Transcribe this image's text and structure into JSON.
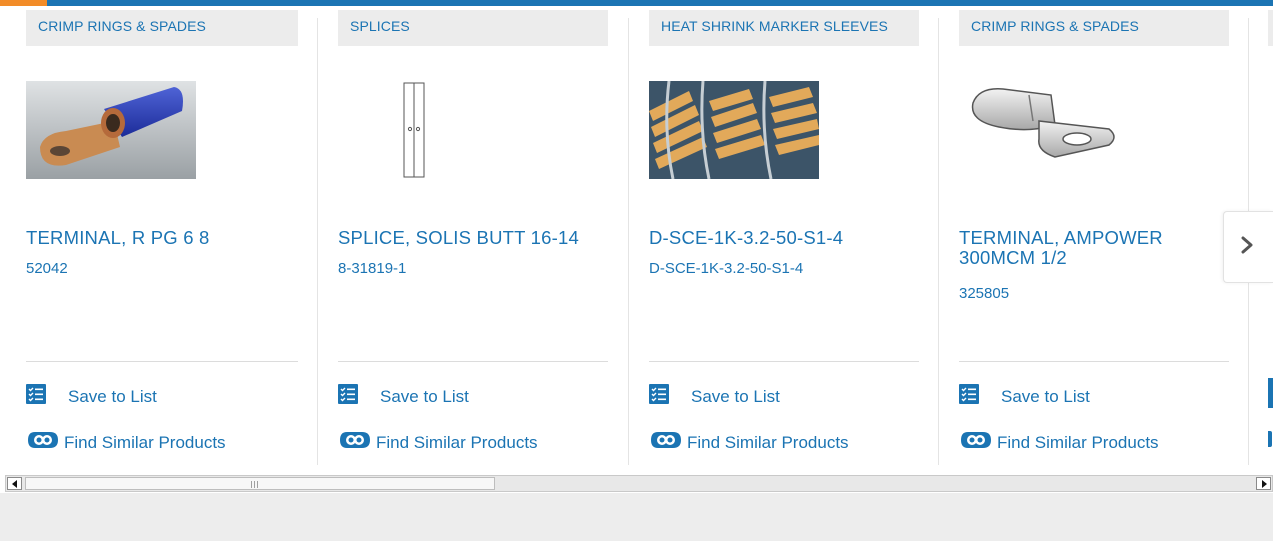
{
  "cards": [
    {
      "category": "CRIMP RINGS & SPADES",
      "name": "TERMINAL, R PG 6 8",
      "number": "52042",
      "image": "ring-terminal",
      "save_label": "Save to List",
      "similar_label": "Find Similar Products"
    },
    {
      "category": "SPLICES",
      "name": "SPLICE, SOLIS BUTT 16-14",
      "number": "8-31819-1",
      "image": "butt-splice",
      "save_label": "Save to List",
      "similar_label": "Find Similar Products"
    },
    {
      "category": "HEAT SHRINK MARKER SLEEVES",
      "name": "D-SCE-1K-3.2-50-S1-4",
      "number": "D-SCE-1K-3.2-50-S1-4",
      "image": "marker-sleeves",
      "save_label": "Save to List",
      "similar_label": "Find Similar Products"
    },
    {
      "category": "CRIMP RINGS & SPADES",
      "name": "TERMINAL, AMPOWER 300MCM 1/2",
      "number": "325805",
      "image": "lug-terminal",
      "save_label": "Save to List",
      "similar_label": "Find Similar Products"
    }
  ],
  "icons": {
    "save": "list-checklist-icon",
    "similar": "find-similar-icon",
    "next": "chevron-right-icon"
  },
  "colors": {
    "link": "#1b74b3",
    "accent": "#f28c28",
    "category_bg": "#ececec"
  }
}
